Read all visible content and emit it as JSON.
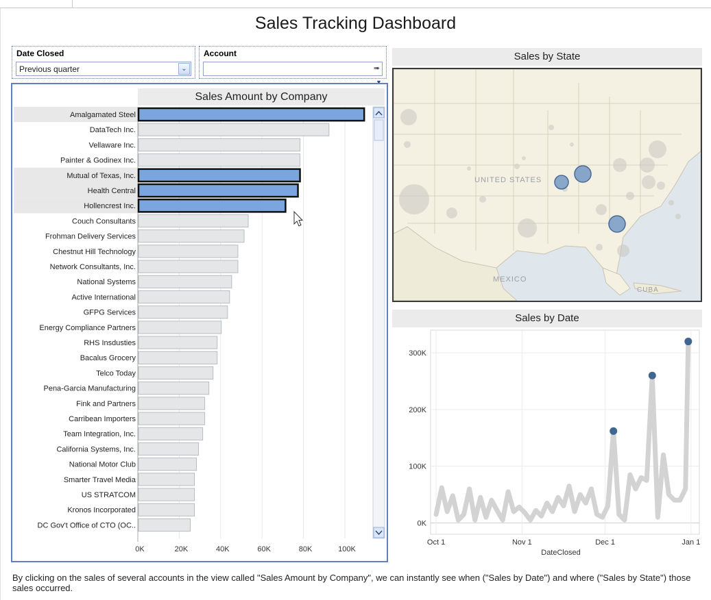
{
  "dashboard": {
    "title": "Sales Tracking Dashboard",
    "caption": "By clicking on the sales of several accounts in the view called \"Sales Amount by Company\", we can instantly see when (\"Sales by Date\") and where (\"Sales by State\") those sales occurred."
  },
  "filters": {
    "date_closed": {
      "label": "Date Closed",
      "value": "Previous quarter",
      "icon": "chevron-down-icon"
    },
    "account": {
      "label": "Account",
      "value": "",
      "icon": "arrow-right-icon"
    }
  },
  "colors": {
    "selected_bar": "#7aa6dd",
    "unselected_bar": "#e4e6e8",
    "bar_outline": "#b8bcc2",
    "selected_outline": "#111111",
    "map_water": "#dfe6ec",
    "map_land": "#f4f1e2",
    "highlight_circle": "#7d9ec8",
    "faded_circle": "#c9c6c1",
    "line_color": "#d3d3d3",
    "point_color": "#3f6591"
  },
  "map": {
    "title": "Sales by State",
    "labels": [
      "UNITED STATES",
      "MEXICO",
      "CUBA"
    ]
  },
  "chart_data": [
    {
      "type": "bar",
      "title": "Sales Amount by Company",
      "orientation": "horizontal",
      "categories": [
        "Amalgamated Steel",
        "DataTech Inc.",
        "Vellaware Inc.",
        "Painter & Godinex Inc.",
        "Mutual of Texas, Inc.",
        "Health Central",
        "Hollencrest Inc.",
        "Couch Consultants",
        "Frohman Delivery Services",
        "Chestnut Hill Technology",
        "Network Consultants, Inc.",
        "National Systems",
        "Active International",
        "GFPG Services",
        "Energy Compliance Partners",
        "RHS Insdusties",
        "Bacalus Grocery",
        "Telco Today",
        "Pena-Garcia Manufacturing",
        "Fink and Partners",
        "Carribean Importers",
        "Team Integration, Inc.",
        "California Systems, Inc.",
        "National Motor Club",
        "Smarter Travel Media",
        "US STRATCOM",
        "Kronos Incorporated",
        "DC Gov't Office of CTO (OC.."
      ],
      "values": [
        109000,
        92000,
        78000,
        78000,
        78000,
        77000,
        71000,
        53000,
        51000,
        48000,
        48000,
        45000,
        44000,
        43000,
        40000,
        38000,
        38000,
        36000,
        34000,
        32000,
        32000,
        31000,
        29000,
        28000,
        27000,
        27000,
        27000,
        25000
      ],
      "selected": [
        "Amalgamated Steel",
        "Mutual of Texas, Inc.",
        "Health Central",
        "Hollencrest Inc."
      ],
      "xlim": [
        0,
        113000
      ],
      "xticks": [
        "0K",
        "20K",
        "40K",
        "60K",
        "80K",
        "100K"
      ],
      "xtick_values": [
        0,
        20000,
        40000,
        60000,
        80000,
        100000
      ]
    },
    {
      "type": "line",
      "title": "Sales by Date",
      "xlabel": "DateClosed",
      "xticks": [
        "Oct 1",
        "Nov 1",
        "Dec 1",
        "Jan 1"
      ],
      "xtick_values": [
        "2011-10-01",
        "2011-11-01",
        "2011-12-01",
        "2012-01-01"
      ],
      "xlim": [
        "2011-09-29",
        "2012-01-04"
      ],
      "yticks": [
        "0K",
        "100K",
        "200K",
        "300K"
      ],
      "ytick_values": [
        0,
        100000,
        200000,
        300000
      ],
      "ylim": [
        -20000,
        340000
      ],
      "series": [
        {
          "x": [
            "2011-10-01",
            "2011-10-03",
            "2011-10-05",
            "2011-10-07",
            "2011-10-09",
            "2011-10-11",
            "2011-10-13",
            "2011-10-15",
            "2011-10-17",
            "2011-10-19",
            "2011-10-21",
            "2011-10-23",
            "2011-10-25",
            "2011-10-27",
            "2011-10-29",
            "2011-10-31",
            "2011-11-02",
            "2011-11-04",
            "2011-11-06",
            "2011-11-08",
            "2011-11-10",
            "2011-11-12",
            "2011-11-14",
            "2011-11-16",
            "2011-11-18",
            "2011-11-20",
            "2011-11-22",
            "2011-11-24",
            "2011-11-26",
            "2011-11-28",
            "2011-11-30",
            "2011-12-02",
            "2011-12-04",
            "2011-12-06",
            "2011-12-08",
            "2011-12-10",
            "2011-12-12",
            "2011-12-14",
            "2011-12-16",
            "2011-12-18",
            "2011-12-20",
            "2011-12-22",
            "2011-12-24",
            "2011-12-26",
            "2011-12-28",
            "2011-12-30",
            "2011-12-31"
          ],
          "values": [
            15000,
            62000,
            20000,
            48000,
            5000,
            15000,
            60000,
            5000,
            45000,
            10000,
            40000,
            22000,
            5000,
            55000,
            20000,
            28000,
            18000,
            5000,
            22000,
            12000,
            35000,
            20000,
            45000,
            30000,
            65000,
            20000,
            50000,
            35000,
            60000,
            15000,
            10000,
            30000,
            162000,
            15000,
            5000,
            85000,
            60000,
            80000,
            75000,
            260000,
            10000,
            120000,
            50000,
            40000,
            40000,
            60000,
            320000
          ]
        }
      ],
      "highlighted_points": [
        {
          "x": "2011-12-04",
          "value": 162000
        },
        {
          "x": "2011-12-18",
          "value": 260000
        },
        {
          "x": "2011-12-31",
          "value": 320000
        }
      ]
    }
  ]
}
